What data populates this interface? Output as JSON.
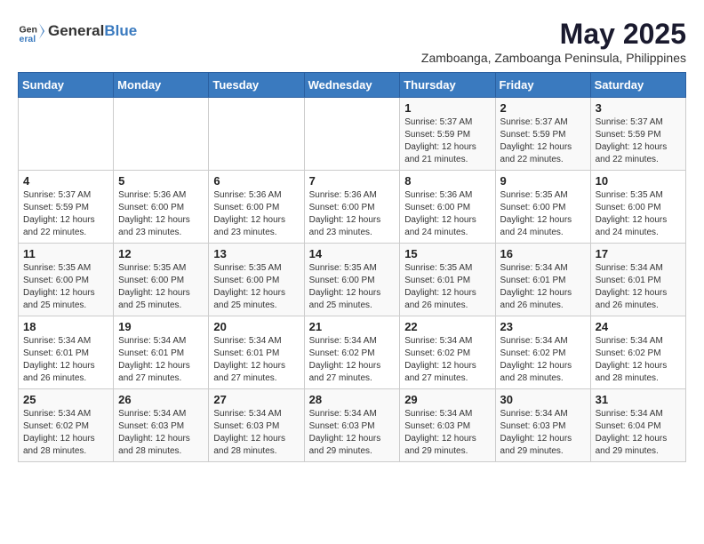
{
  "header": {
    "logo": {
      "general": "General",
      "blue": "Blue"
    },
    "title": "May 2025",
    "subtitle": "Zamboanga, Zamboanga Peninsula, Philippines"
  },
  "weekdays": [
    "Sunday",
    "Monday",
    "Tuesday",
    "Wednesday",
    "Thursday",
    "Friday",
    "Saturday"
  ],
  "weeks": [
    [
      {
        "day": "",
        "info": ""
      },
      {
        "day": "",
        "info": ""
      },
      {
        "day": "",
        "info": ""
      },
      {
        "day": "",
        "info": ""
      },
      {
        "day": "1",
        "info": "Sunrise: 5:37 AM\nSunset: 5:59 PM\nDaylight: 12 hours and 21 minutes."
      },
      {
        "day": "2",
        "info": "Sunrise: 5:37 AM\nSunset: 5:59 PM\nDaylight: 12 hours and 22 minutes."
      },
      {
        "day": "3",
        "info": "Sunrise: 5:37 AM\nSunset: 5:59 PM\nDaylight: 12 hours and 22 minutes."
      }
    ],
    [
      {
        "day": "4",
        "info": "Sunrise: 5:37 AM\nSunset: 5:59 PM\nDaylight: 12 hours and 22 minutes."
      },
      {
        "day": "5",
        "info": "Sunrise: 5:36 AM\nSunset: 6:00 PM\nDaylight: 12 hours and 23 minutes."
      },
      {
        "day": "6",
        "info": "Sunrise: 5:36 AM\nSunset: 6:00 PM\nDaylight: 12 hours and 23 minutes."
      },
      {
        "day": "7",
        "info": "Sunrise: 5:36 AM\nSunset: 6:00 PM\nDaylight: 12 hours and 23 minutes."
      },
      {
        "day": "8",
        "info": "Sunrise: 5:36 AM\nSunset: 6:00 PM\nDaylight: 12 hours and 24 minutes."
      },
      {
        "day": "9",
        "info": "Sunrise: 5:35 AM\nSunset: 6:00 PM\nDaylight: 12 hours and 24 minutes."
      },
      {
        "day": "10",
        "info": "Sunrise: 5:35 AM\nSunset: 6:00 PM\nDaylight: 12 hours and 24 minutes."
      }
    ],
    [
      {
        "day": "11",
        "info": "Sunrise: 5:35 AM\nSunset: 6:00 PM\nDaylight: 12 hours and 25 minutes."
      },
      {
        "day": "12",
        "info": "Sunrise: 5:35 AM\nSunset: 6:00 PM\nDaylight: 12 hours and 25 minutes."
      },
      {
        "day": "13",
        "info": "Sunrise: 5:35 AM\nSunset: 6:00 PM\nDaylight: 12 hours and 25 minutes."
      },
      {
        "day": "14",
        "info": "Sunrise: 5:35 AM\nSunset: 6:00 PM\nDaylight: 12 hours and 25 minutes."
      },
      {
        "day": "15",
        "info": "Sunrise: 5:35 AM\nSunset: 6:01 PM\nDaylight: 12 hours and 26 minutes."
      },
      {
        "day": "16",
        "info": "Sunrise: 5:34 AM\nSunset: 6:01 PM\nDaylight: 12 hours and 26 minutes."
      },
      {
        "day": "17",
        "info": "Sunrise: 5:34 AM\nSunset: 6:01 PM\nDaylight: 12 hours and 26 minutes."
      }
    ],
    [
      {
        "day": "18",
        "info": "Sunrise: 5:34 AM\nSunset: 6:01 PM\nDaylight: 12 hours and 26 minutes."
      },
      {
        "day": "19",
        "info": "Sunrise: 5:34 AM\nSunset: 6:01 PM\nDaylight: 12 hours and 27 minutes."
      },
      {
        "day": "20",
        "info": "Sunrise: 5:34 AM\nSunset: 6:01 PM\nDaylight: 12 hours and 27 minutes."
      },
      {
        "day": "21",
        "info": "Sunrise: 5:34 AM\nSunset: 6:02 PM\nDaylight: 12 hours and 27 minutes."
      },
      {
        "day": "22",
        "info": "Sunrise: 5:34 AM\nSunset: 6:02 PM\nDaylight: 12 hours and 27 minutes."
      },
      {
        "day": "23",
        "info": "Sunrise: 5:34 AM\nSunset: 6:02 PM\nDaylight: 12 hours and 28 minutes."
      },
      {
        "day": "24",
        "info": "Sunrise: 5:34 AM\nSunset: 6:02 PM\nDaylight: 12 hours and 28 minutes."
      }
    ],
    [
      {
        "day": "25",
        "info": "Sunrise: 5:34 AM\nSunset: 6:02 PM\nDaylight: 12 hours and 28 minutes."
      },
      {
        "day": "26",
        "info": "Sunrise: 5:34 AM\nSunset: 6:03 PM\nDaylight: 12 hours and 28 minutes."
      },
      {
        "day": "27",
        "info": "Sunrise: 5:34 AM\nSunset: 6:03 PM\nDaylight: 12 hours and 28 minutes."
      },
      {
        "day": "28",
        "info": "Sunrise: 5:34 AM\nSunset: 6:03 PM\nDaylight: 12 hours and 29 minutes."
      },
      {
        "day": "29",
        "info": "Sunrise: 5:34 AM\nSunset: 6:03 PM\nDaylight: 12 hours and 29 minutes."
      },
      {
        "day": "30",
        "info": "Sunrise: 5:34 AM\nSunset: 6:03 PM\nDaylight: 12 hours and 29 minutes."
      },
      {
        "day": "31",
        "info": "Sunrise: 5:34 AM\nSunset: 6:04 PM\nDaylight: 12 hours and 29 minutes."
      }
    ]
  ]
}
